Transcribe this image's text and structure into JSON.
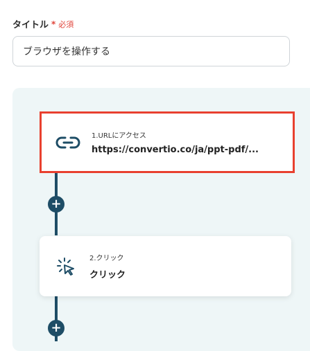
{
  "form": {
    "title_label": "タイトル",
    "required_mark": "*",
    "required_text": "必須",
    "title_value": "ブラウザを操作する"
  },
  "steps": [
    {
      "label": "1.URLにアクセス",
      "value": "https://convertio.co/ja/ppt-pdf/...",
      "icon": "link-icon"
    },
    {
      "label": "2.クリック",
      "value": "クリック",
      "icon": "click-cursor-icon"
    }
  ],
  "add_button_glyph": "+",
  "colors": {
    "accent": "#1e4d66",
    "selection": "#e8402f",
    "required": "#e0443a",
    "panel_bg": "#eef6f7"
  }
}
